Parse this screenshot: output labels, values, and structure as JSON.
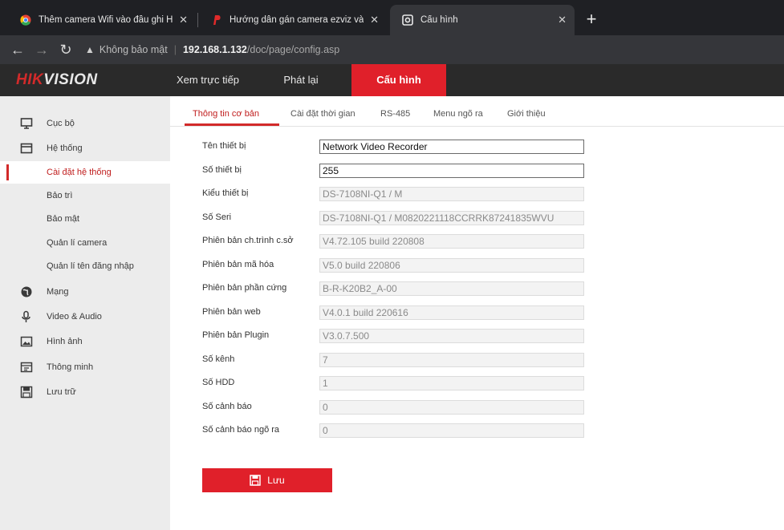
{
  "browser": {
    "tabs": [
      {
        "title": "Thêm camera Wifi vào đầu ghi H",
        "icon": "chrome-icon"
      },
      {
        "title": "Hướng dẫn gán camera ezviz vào",
        "icon": "p-logo-icon"
      },
      {
        "title": "Cấu hình",
        "icon": "camera-page-icon"
      }
    ],
    "security_label": "Không bảo mật",
    "url_host": "192.168.1.132",
    "url_path": "/doc/page/config.asp"
  },
  "app": {
    "logo_hik": "HIK",
    "logo_vision": "VISION",
    "nav": [
      "Xem trực tiếp",
      "Phát lại",
      "Cấu hình"
    ]
  },
  "sidebar": {
    "items": [
      {
        "label": "Cục bộ",
        "icon": "monitor-icon"
      },
      {
        "label": "Hệ thống",
        "icon": "window-icon"
      },
      {
        "label": "Cài đặt hệ thống"
      },
      {
        "label": "Bảo trì"
      },
      {
        "label": "Bảo mật"
      },
      {
        "label": "Quản lí camera"
      },
      {
        "label": "Quản lí tên đăng nhập"
      },
      {
        "label": "Mạng",
        "icon": "globe-icon"
      },
      {
        "label": "Video & Audio",
        "icon": "mic-icon"
      },
      {
        "label": "Hình ảnh",
        "icon": "image-icon"
      },
      {
        "label": "Thông minh",
        "icon": "calendar-icon"
      },
      {
        "label": "Lưu trữ",
        "icon": "storage-icon"
      }
    ]
  },
  "subtabs": [
    "Thông tin cơ bản",
    "Cài đặt thời gian",
    "RS-485",
    "Menu ngõ ra",
    "Giới thiệu"
  ],
  "form": [
    {
      "label": "Tên thiết bị",
      "value": "Network Video Recorder",
      "editable": true
    },
    {
      "label": "Số thiết bị",
      "value": "255",
      "editable": true
    },
    {
      "label": "Kiểu thiết bị",
      "value": "DS-7108NI-Q1 / M",
      "editable": false
    },
    {
      "label": "Số Seri",
      "value": "DS-7108NI-Q1 / M0820221118CCRRK87241835WVU",
      "editable": false
    },
    {
      "label": "Phiên bản ch.trình c.sở",
      "value": "V4.72.105 build 220808",
      "editable": false
    },
    {
      "label": "Phiên bản mã hóa",
      "value": "V5.0 build 220806",
      "editable": false
    },
    {
      "label": "Phiên bản phần cứng",
      "value": "B-R-K20B2_A-00",
      "editable": false
    },
    {
      "label": "Phiên bản web",
      "value": "V4.0.1 build 220616",
      "editable": false
    },
    {
      "label": "Phiên bản Plugin",
      "value": "V3.0.7.500",
      "editable": false
    },
    {
      "label": "Số kênh",
      "value": "7",
      "editable": false
    },
    {
      "label": "Số HDD",
      "value": "1",
      "editable": false
    },
    {
      "label": "Số cảnh báo",
      "value": "0",
      "editable": false
    },
    {
      "label": "Số cảnh báo ngõ ra",
      "value": "0",
      "editable": false
    }
  ],
  "save_label": "Lưu",
  "colors": {
    "accent": "#e0202a",
    "header": "#2a2a2a",
    "sidebar": "#ececec"
  }
}
